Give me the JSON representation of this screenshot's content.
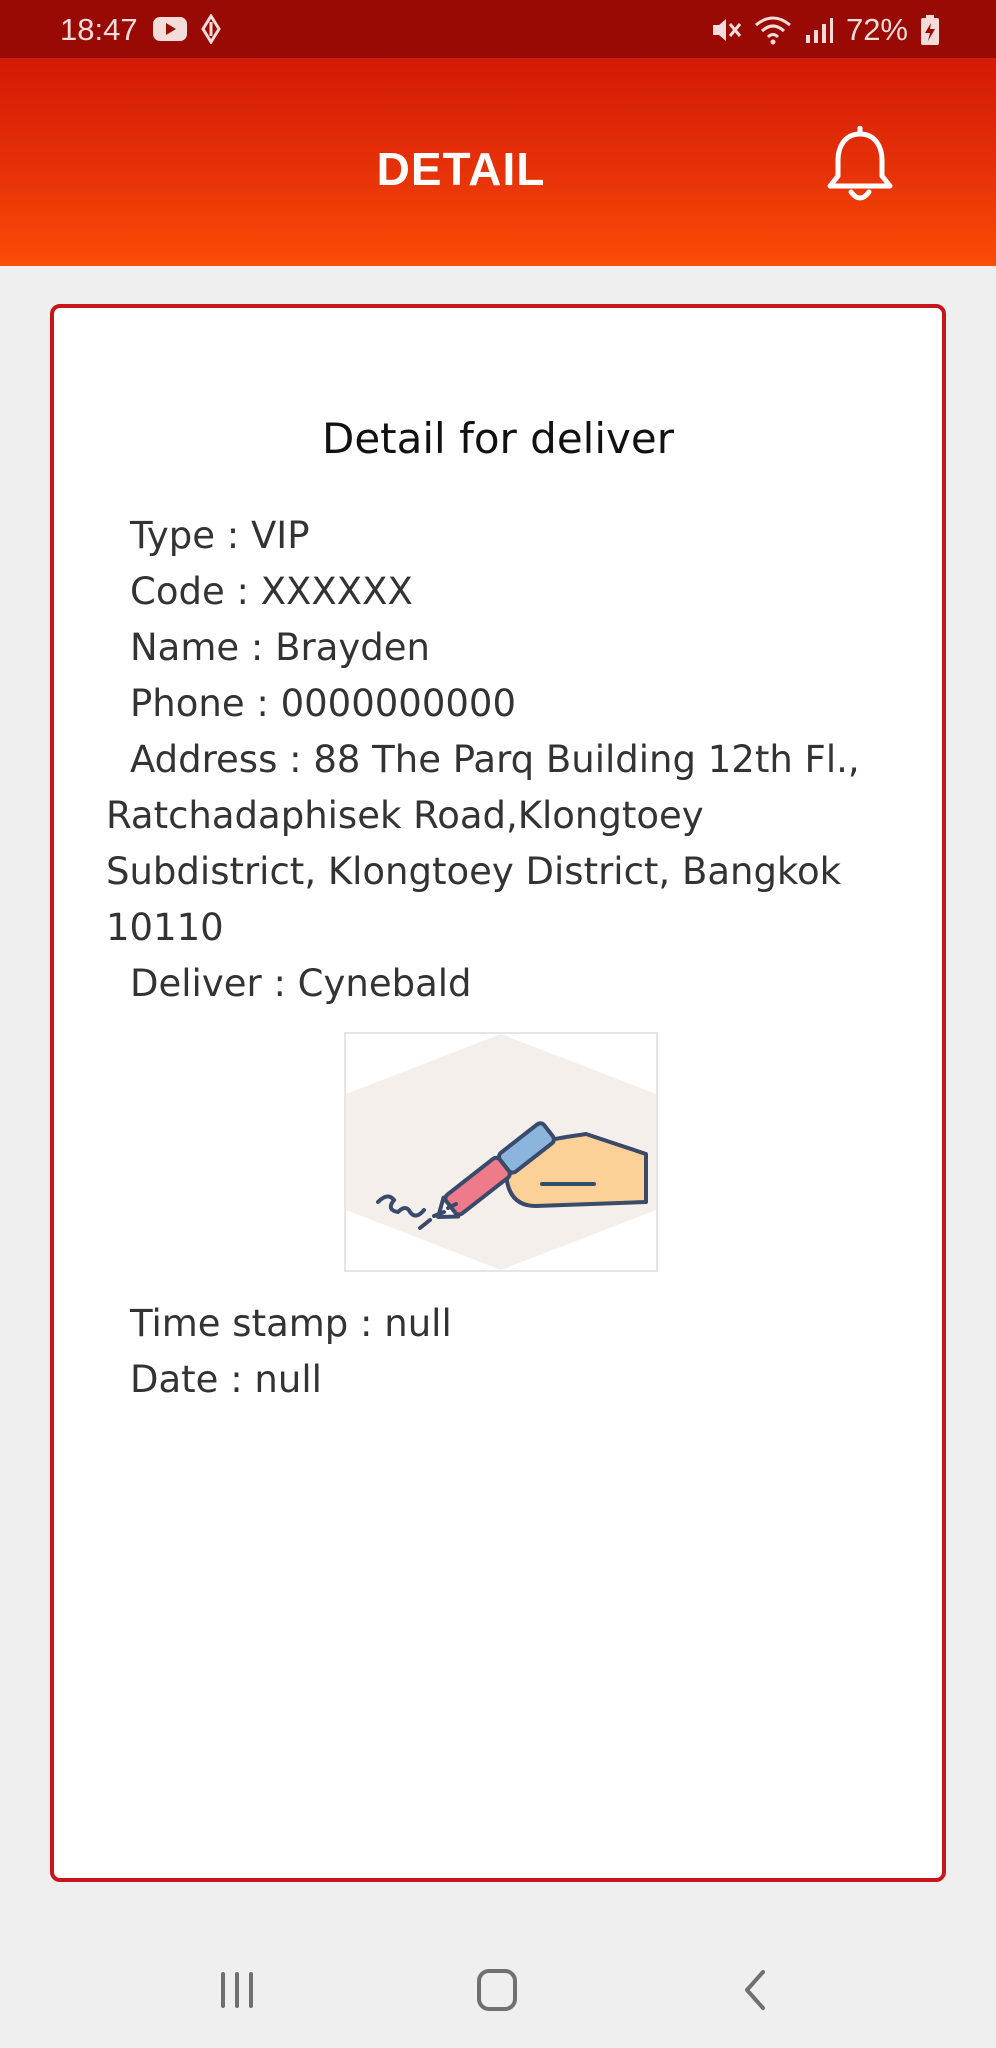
{
  "status_bar": {
    "time": "18:47",
    "battery": "72%",
    "icons": [
      "youtube-icon",
      "navigation-icon",
      "mute-icon",
      "wifi-icon",
      "signal-icon",
      "battery-icon"
    ]
  },
  "app_bar": {
    "title": "DETAIL",
    "right_icon": "bell-icon"
  },
  "detail": {
    "heading": "Detail for deliver",
    "type": "Type : VIP",
    "code": "Code : XXXXXX",
    "name": "Name : Brayden",
    "phone": "Phone : 0000000000",
    "address": "Address : 88 The Parq Building 12th Fl., Ratchadaphisek Road,Klongtoey Subdistrict, Klongtoey District, Bangkok 10110",
    "deliver": "Deliver : Cynebald",
    "signature_icon": "signature-hand-pen-icon",
    "time_stamp": "Time stamp : null",
    "date": "Date : null"
  },
  "nav_bar": {
    "buttons": [
      "recent-apps-icon",
      "home-icon",
      "back-icon"
    ]
  },
  "colors": {
    "status_bar": "#9a0a04",
    "app_bar_top": "#d21a06",
    "app_bar_bottom": "#fb4d06",
    "card_border": "#c8151a"
  }
}
